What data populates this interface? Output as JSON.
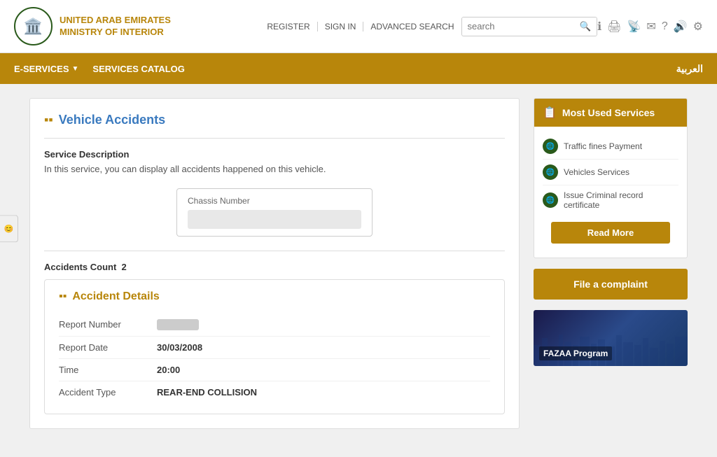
{
  "header": {
    "logo_emoji": "🏛️",
    "logo_line1": "UNITED ARAB EMIRATES",
    "logo_line2": "MINISTRY OF INTERIOR",
    "nav": {
      "register": "REGISTER",
      "sign_in": "SIGN IN",
      "advanced_search": "ADVANCED SEARCH"
    },
    "search_placeholder": "search",
    "icons": [
      "ℹ",
      "🖨",
      "📡",
      "✉",
      "?",
      "🔊",
      "⚙"
    ]
  },
  "navbar": {
    "eservices_label": "E-SERVICES",
    "services_catalog_label": "SERVICES CATALOG",
    "arabic_label": "العربية"
  },
  "page": {
    "title": "Vehicle Accidents",
    "service_description_label": "Service Description",
    "service_description_text": "In this service, you can display all accidents happened on this vehicle.",
    "chassis_label": "Chassis Number",
    "chassis_placeholder": "",
    "accidents_count_label": "Accidents Count",
    "accidents_count_value": "2"
  },
  "accident_card": {
    "title": "Accident Details",
    "fields": [
      {
        "label": "Report Number",
        "value": "",
        "blurred": true
      },
      {
        "label": "Report Date",
        "value": "30/03/2008",
        "blurred": false
      },
      {
        "label": "Time",
        "value": "20:00",
        "blurred": false
      },
      {
        "label": "Accident Type",
        "value": "REAR-END COLLISION",
        "blurred": false
      }
    ]
  },
  "sidebar": {
    "most_used_services": {
      "title": "Most Used Services",
      "items": [
        {
          "label": "Traffic fines Payment"
        },
        {
          "label": "Vehicles Services"
        },
        {
          "label": "Issue Criminal record certificate"
        }
      ],
      "read_more_label": "Read More"
    },
    "complaint_button_label": "File a complaint",
    "fazaa_label": "FAZAA Program"
  },
  "feedback_tab_label": "😊"
}
